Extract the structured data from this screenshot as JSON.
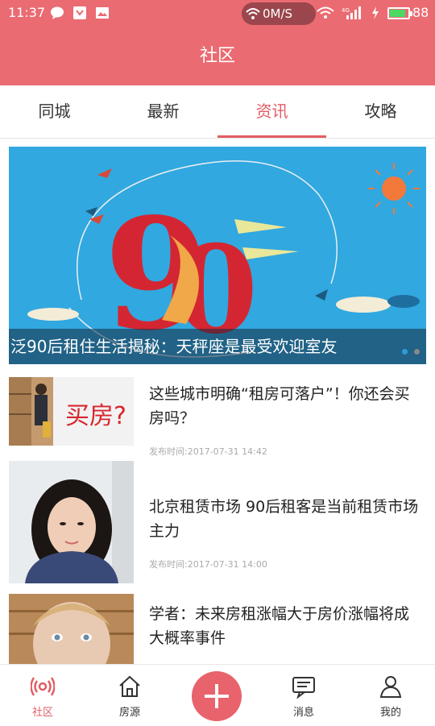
{
  "status_bar": {
    "time": "11:37",
    "speed": "0M/S",
    "battery": "88",
    "battery_level": 0.88
  },
  "header": {
    "title": "社区"
  },
  "tabs": [
    {
      "label": "同城",
      "active": false
    },
    {
      "label": "最新",
      "active": false
    },
    {
      "label": "资讯",
      "active": true
    },
    {
      "label": "攻略",
      "active": false
    }
  ],
  "banner": {
    "caption": "泛90后租住生活揭秘：天秤座是最受欢迎室友",
    "graphic_text": "9",
    "graphic_text2": "0",
    "page": 1,
    "pages": 2
  },
  "news": [
    {
      "title": "这些城市明确“租房可落户”！你还会买房吗？",
      "meta": "发布时间:2017-07-31 14:42",
      "thumb_text": "买房?"
    },
    {
      "title": "北京租赁市场 90后租客是当前租赁市场主力",
      "meta": "发布时间:2017-07-31 14:00"
    },
    {
      "title": "学者：未来房租涨幅大于房价涨幅将成大概率事件"
    }
  ],
  "bottom_nav": {
    "community": "社区",
    "listings": "房源",
    "messages": "消息",
    "mine": "我的"
  },
  "colors": {
    "brand": "#ea6b72",
    "accent": "#e25d66"
  }
}
